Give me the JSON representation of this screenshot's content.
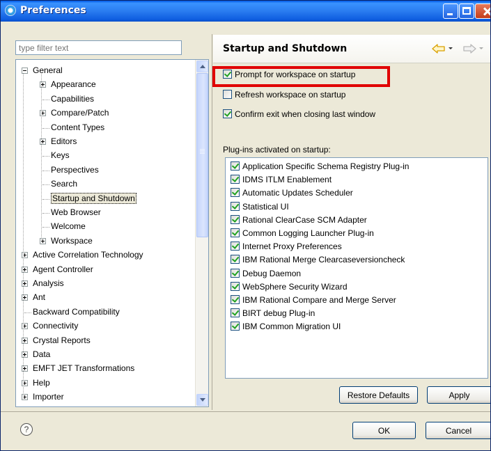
{
  "window": {
    "title": "Preferences"
  },
  "filter": {
    "placeholder": "type filter text"
  },
  "tree": {
    "items": [
      {
        "label": "General",
        "level": 0,
        "expander": "minus"
      },
      {
        "label": "Appearance",
        "level": 1,
        "expander": "plus"
      },
      {
        "label": "Capabilities",
        "level": 1,
        "expander": "none"
      },
      {
        "label": "Compare/Patch",
        "level": 1,
        "expander": "plus"
      },
      {
        "label": "Content Types",
        "level": 1,
        "expander": "none"
      },
      {
        "label": "Editors",
        "level": 1,
        "expander": "plus"
      },
      {
        "label": "Keys",
        "level": 1,
        "expander": "none"
      },
      {
        "label": "Perspectives",
        "level": 1,
        "expander": "none"
      },
      {
        "label": "Search",
        "level": 1,
        "expander": "none"
      },
      {
        "label": "Startup and Shutdown",
        "level": 1,
        "expander": "none",
        "selected": true
      },
      {
        "label": "Web Browser",
        "level": 1,
        "expander": "none"
      },
      {
        "label": "Welcome",
        "level": 1,
        "expander": "none"
      },
      {
        "label": "Workspace",
        "level": 1,
        "expander": "plus"
      },
      {
        "label": "Active Correlation Technology",
        "level": 0,
        "expander": "plus"
      },
      {
        "label": "Agent Controller",
        "level": 0,
        "expander": "plus"
      },
      {
        "label": "Analysis",
        "level": 0,
        "expander": "plus"
      },
      {
        "label": "Ant",
        "level": 0,
        "expander": "plus"
      },
      {
        "label": "Backward Compatibility",
        "level": 0,
        "expander": "none"
      },
      {
        "label": "Connectivity",
        "level": 0,
        "expander": "plus"
      },
      {
        "label": "Crystal Reports",
        "level": 0,
        "expander": "plus"
      },
      {
        "label": "Data",
        "level": 0,
        "expander": "plus"
      },
      {
        "label": "EMFT JET Transformations",
        "level": 0,
        "expander": "plus"
      },
      {
        "label": "Help",
        "level": 0,
        "expander": "plus"
      },
      {
        "label": "Importer",
        "level": 0,
        "expander": "plus"
      }
    ]
  },
  "page": {
    "title": "Startup and Shutdown",
    "options": [
      {
        "label": "Prompt for workspace on startup",
        "checked": true
      },
      {
        "label": "Refresh workspace on startup",
        "checked": false
      },
      {
        "label": "Confirm exit when closing last window",
        "checked": true
      }
    ],
    "plugins_label": "Plug-ins activated on startup:",
    "plugins": [
      {
        "label": "Application Specific Schema Registry Plug-in",
        "checked": true
      },
      {
        "label": "IDMS ITLM Enablement",
        "checked": true
      },
      {
        "label": "Automatic Updates Scheduler",
        "checked": true
      },
      {
        "label": "Statistical UI",
        "checked": true
      },
      {
        "label": "Rational ClearCase SCM Adapter",
        "checked": true
      },
      {
        "label": "Common Logging Launcher Plug-in",
        "checked": true
      },
      {
        "label": "Internet Proxy Preferences",
        "checked": true
      },
      {
        "label": "IBM Rational Merge Clearcaseversioncheck",
        "checked": true
      },
      {
        "label": "Debug Daemon",
        "checked": true
      },
      {
        "label": "WebSphere Security Wizard",
        "checked": true
      },
      {
        "label": "IBM Rational Compare and Merge Server",
        "checked": true
      },
      {
        "label": "BIRT debug Plug-in",
        "checked": true
      },
      {
        "label": "IBM Common Migration UI",
        "checked": true
      }
    ],
    "restore_defaults": "Restore Defaults",
    "apply": "Apply"
  },
  "footer": {
    "help": "?",
    "ok": "OK",
    "cancel": "Cancel"
  },
  "colors": {
    "highlight": "#e00000",
    "check": "#21a121",
    "title_bar": "#0058e6",
    "nav_arrow": "#f0b000"
  }
}
